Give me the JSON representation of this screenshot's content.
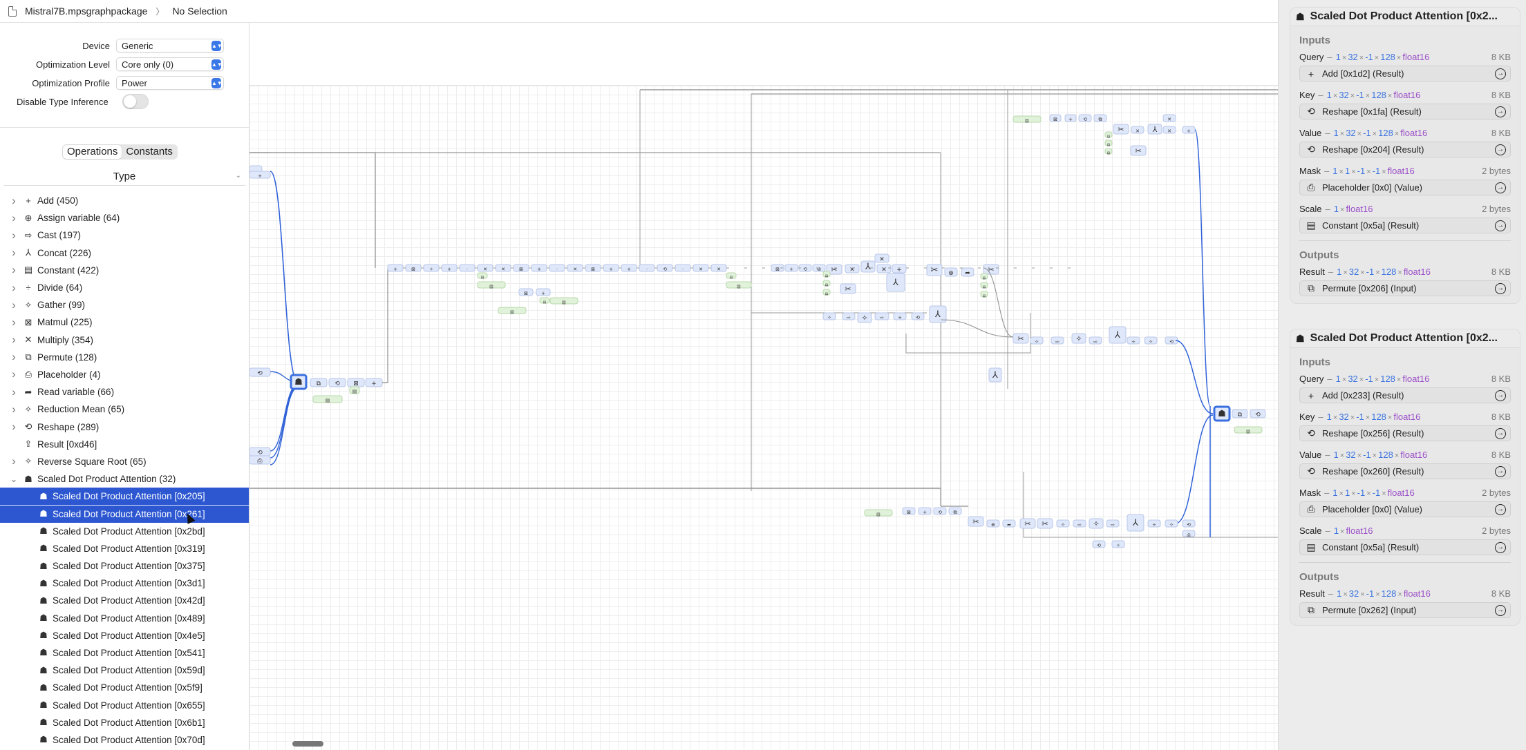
{
  "breadcrumb": {
    "file": "Mistral7B.mpsgraphpackage",
    "separator": "〉",
    "selection": "No Selection"
  },
  "settings": {
    "device": {
      "label": "Device",
      "value": "Generic"
    },
    "optimization_level": {
      "label": "Optimization Level",
      "value": "Core only (0)"
    },
    "optimization_profile": {
      "label": "Optimization Profile",
      "value": "Power"
    },
    "disable_type_inference": {
      "label": "Disable Type Inference",
      "on": false
    }
  },
  "segmented": {
    "operations": "Operations",
    "constants": "Constants",
    "selected": "Operations"
  },
  "list_header": "Type",
  "operation_types": [
    {
      "icon": "plus-icon",
      "glyph": "+",
      "label": "Add (450)",
      "expanded": false
    },
    {
      "icon": "assign-variable-icon",
      "glyph": "⊕",
      "label": "Assign variable (64)",
      "expanded": false
    },
    {
      "icon": "cast-icon",
      "glyph": "⇨",
      "label": "Cast (197)",
      "expanded": false
    },
    {
      "icon": "concat-icon",
      "glyph": "⅄",
      "label": "Concat (226)",
      "expanded": false
    },
    {
      "icon": "table-icon",
      "glyph": "▤",
      "label": "Constant (422)",
      "expanded": false
    },
    {
      "icon": "divide-icon",
      "glyph": "÷",
      "label": "Divide (64)",
      "expanded": false
    },
    {
      "icon": "sparkle-icon",
      "glyph": "✧",
      "label": "Gather (99)",
      "expanded": false
    },
    {
      "icon": "matmul-icon",
      "glyph": "⊠",
      "label": "Matmul (225)",
      "expanded": false
    },
    {
      "icon": "multiply-icon",
      "glyph": "✕",
      "label": "Multiply (354)",
      "expanded": false
    },
    {
      "icon": "permute-icon",
      "glyph": "⧉",
      "label": "Permute (128)",
      "expanded": false
    },
    {
      "icon": "placeholder-icon",
      "glyph": "⎙",
      "label": "Placeholder (4)",
      "expanded": false
    },
    {
      "icon": "read-variable-icon",
      "glyph": "➦",
      "label": "Read variable (66)",
      "expanded": false
    },
    {
      "icon": "sparkle-icon",
      "glyph": "✧",
      "label": "Reduction Mean (65)",
      "expanded": false
    },
    {
      "icon": "reshape-icon",
      "glyph": "⟲",
      "label": "Reshape (289)",
      "expanded": false
    },
    {
      "icon": "share-icon",
      "glyph": "⇪",
      "label": "Result [0xd46]",
      "leaf": true
    },
    {
      "icon": "sparkle-icon",
      "glyph": "✧",
      "label": "Reverse Square Root (65)",
      "expanded": false
    },
    {
      "icon": "brain-icon",
      "glyph": "☗",
      "label": "Scaled Dot Product Attention (32)",
      "expanded": true
    }
  ],
  "sdpa_children": [
    {
      "label": "Scaled Dot Product Attention [0x205]",
      "selected": true
    },
    {
      "label": "Scaled Dot Product Attention [0x261]",
      "selected": true
    },
    {
      "label": "Scaled Dot Product Attention [0x2bd]",
      "selected": false
    },
    {
      "label": "Scaled Dot Product Attention [0x319]",
      "selected": false
    },
    {
      "label": "Scaled Dot Product Attention [0x375]",
      "selected": false
    },
    {
      "label": "Scaled Dot Product Attention [0x3d1]",
      "selected": false
    },
    {
      "label": "Scaled Dot Product Attention [0x42d]",
      "selected": false
    },
    {
      "label": "Scaled Dot Product Attention [0x489]",
      "selected": false
    },
    {
      "label": "Scaled Dot Product Attention [0x4e5]",
      "selected": false
    },
    {
      "label": "Scaled Dot Product Attention [0x541]",
      "selected": false
    },
    {
      "label": "Scaled Dot Product Attention [0x59d]",
      "selected": false
    },
    {
      "label": "Scaled Dot Product Attention [0x5f9]",
      "selected": false
    },
    {
      "label": "Scaled Dot Product Attention [0x655]",
      "selected": false
    },
    {
      "label": "Scaled Dot Product Attention [0x6b1]",
      "selected": false
    },
    {
      "label": "Scaled Dot Product Attention [0x70d]",
      "selected": false
    }
  ],
  "inspector": [
    {
      "title": "Scaled Dot Product Attention [0x2...",
      "inputs_label": "Inputs",
      "inputs": [
        {
          "name": "Query",
          "shape": [
            "1",
            "32",
            "-1",
            "128"
          ],
          "dtype": "float16",
          "size": "8 KB",
          "source_icon": "plus-icon",
          "source_glyph": "+",
          "source": "Add [0x1d2] (Result)"
        },
        {
          "name": "Key",
          "shape": [
            "1",
            "32",
            "-1",
            "128"
          ],
          "dtype": "float16",
          "size": "8 KB",
          "source_icon": "reshape-icon",
          "source_glyph": "⟲",
          "source": "Reshape [0x1fa] (Result)"
        },
        {
          "name": "Value",
          "shape": [
            "1",
            "32",
            "-1",
            "128"
          ],
          "dtype": "float16",
          "size": "8 KB",
          "source_icon": "reshape-icon",
          "source_glyph": "⟲",
          "source": "Reshape [0x204] (Result)"
        },
        {
          "name": "Mask",
          "shape": [
            "1",
            "1",
            "-1",
            "-1"
          ],
          "dtype": "float16",
          "size": "2 bytes",
          "source_icon": "placeholder-icon",
          "source_glyph": "⎙",
          "source": "Placeholder [0x0] (Value)"
        },
        {
          "name": "Scale",
          "shape": [
            "1"
          ],
          "dtype": "float16",
          "size": "2 bytes",
          "source_icon": "table-icon",
          "source_glyph": "▤",
          "source": "Constant [0x5a] (Result)"
        }
      ],
      "outputs_label": "Outputs",
      "outputs": [
        {
          "name": "Result",
          "shape": [
            "1",
            "32",
            "-1",
            "128"
          ],
          "dtype": "float16",
          "size": "8 KB",
          "source_icon": "permute-icon",
          "source_glyph": "⧉",
          "source": "Permute [0x206] (Input)"
        }
      ]
    },
    {
      "title": "Scaled Dot Product Attention [0x2...",
      "inputs_label": "Inputs",
      "inputs": [
        {
          "name": "Query",
          "shape": [
            "1",
            "32",
            "-1",
            "128"
          ],
          "dtype": "float16",
          "size": "8 KB",
          "source_icon": "plus-icon",
          "source_glyph": "+",
          "source": "Add [0x233] (Result)"
        },
        {
          "name": "Key",
          "shape": [
            "1",
            "32",
            "-1",
            "128"
          ],
          "dtype": "float16",
          "size": "8 KB",
          "source_icon": "reshape-icon",
          "source_glyph": "⟲",
          "source": "Reshape [0x256] (Result)"
        },
        {
          "name": "Value",
          "shape": [
            "1",
            "32",
            "-1",
            "128"
          ],
          "dtype": "float16",
          "size": "8 KB",
          "source_icon": "reshape-icon",
          "source_glyph": "⟲",
          "source": "Reshape [0x260] (Result)"
        },
        {
          "name": "Mask",
          "shape": [
            "1",
            "1",
            "-1",
            "-1"
          ],
          "dtype": "float16",
          "size": "2 bytes",
          "source_icon": "placeholder-icon",
          "source_glyph": "⎙",
          "source": "Placeholder [0x0] (Value)"
        },
        {
          "name": "Scale",
          "shape": [
            "1"
          ],
          "dtype": "float16",
          "size": "2 bytes",
          "source_icon": "table-icon",
          "source_glyph": "▤",
          "source": "Constant [0x5a] (Result)"
        }
      ],
      "outputs_label": "Outputs",
      "outputs": [
        {
          "name": "Result",
          "shape": [
            "1",
            "32",
            "-1",
            "128"
          ],
          "dtype": "float16",
          "size": "8 KB",
          "source_icon": "permute-icon",
          "source_glyph": "⧉",
          "source": "Permute [0x262] (Input)"
        }
      ]
    }
  ],
  "graph": {
    "node_glyphs": [
      "+",
      "⊠",
      "✧",
      "✕",
      "⧉",
      "⟲",
      "▤",
      "⅄",
      "✂",
      "⊕",
      "➦",
      "÷",
      "⇨",
      "☗"
    ],
    "colors": {
      "op_fill": "#dfe7fa",
      "op_border": "#b9c7e8",
      "const_fill": "#e1f2da",
      "const_border": "#b8d8ab",
      "edge": "#8f8f8f",
      "highlight_edge": "#2f62d8",
      "selected_border": "#3b6fe0"
    }
  }
}
